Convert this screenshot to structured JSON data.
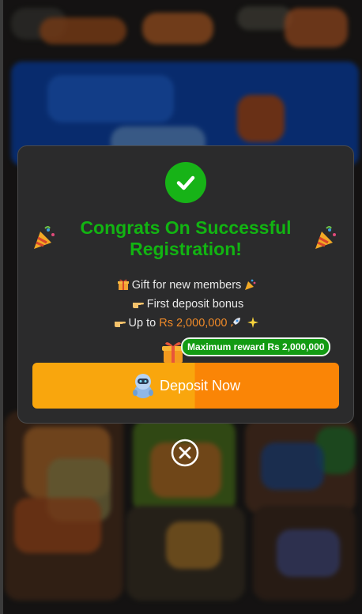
{
  "modal": {
    "title": "Congrats On Successful Registration!",
    "perks": [
      {
        "text": "Gift for new members",
        "icon": "gift-box-icon",
        "trail_icon": "party-popper-icon"
      },
      {
        "text": "First deposit bonus",
        "icon": "pointing-hand-icon"
      },
      {
        "prefix": "Up to",
        "amount": "Rs 2,000,000",
        "icon": "pointing-hand-icon",
        "trail_icons": [
          "rocket-icon",
          "sparkles-icon"
        ]
      }
    ],
    "badge": "Maximum reward Rs 2,000,000",
    "deposit_button": "Deposit Now",
    "colors": {
      "title": "#12b412",
      "amount": "#f08a28",
      "button_left": "#f9a60d",
      "button_right": "#fa8506",
      "badge": "#139b13",
      "check": "#17b317"
    }
  }
}
